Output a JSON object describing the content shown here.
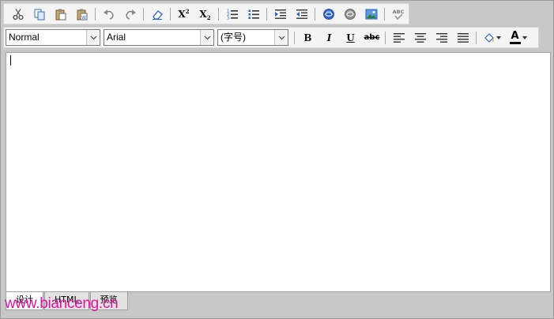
{
  "toolbar1": {
    "buttons": [
      {
        "name": "cut-icon"
      },
      {
        "name": "copy-icon"
      },
      {
        "name": "paste-icon"
      },
      {
        "name": "paste-word-icon"
      },
      {
        "name": "undo-icon"
      },
      {
        "name": "redo-icon"
      },
      {
        "name": "eraser-icon"
      },
      {
        "name": "superscript-icon",
        "label": "X",
        "sup": "2"
      },
      {
        "name": "subscript-icon",
        "label": "X",
        "sub": "2"
      },
      {
        "name": "ordered-list-icon"
      },
      {
        "name": "unordered-list-icon"
      },
      {
        "name": "indent-icon"
      },
      {
        "name": "outdent-icon"
      },
      {
        "name": "link-icon"
      },
      {
        "name": "unlink-icon"
      },
      {
        "name": "image-icon"
      },
      {
        "name": "spellcheck-icon",
        "label": "ABC"
      }
    ]
  },
  "toolbar2": {
    "format_value": "Normal",
    "font_value": "Arial",
    "size_value": "(字号)",
    "bold_label": "B",
    "italic_label": "I",
    "underline_label": "U",
    "strike_label": "abc",
    "fontcolor_label": "A"
  },
  "tabs": [
    {
      "label": "设计",
      "active": true
    },
    {
      "label": "HTML",
      "active": false
    },
    {
      "label": "预览",
      "active": false
    }
  ],
  "watermark": "www.bianceng.cn",
  "colors": {
    "accent_blue": "#2b63c8",
    "watermark": "#e0149c",
    "font_color_bar": "#000000"
  }
}
